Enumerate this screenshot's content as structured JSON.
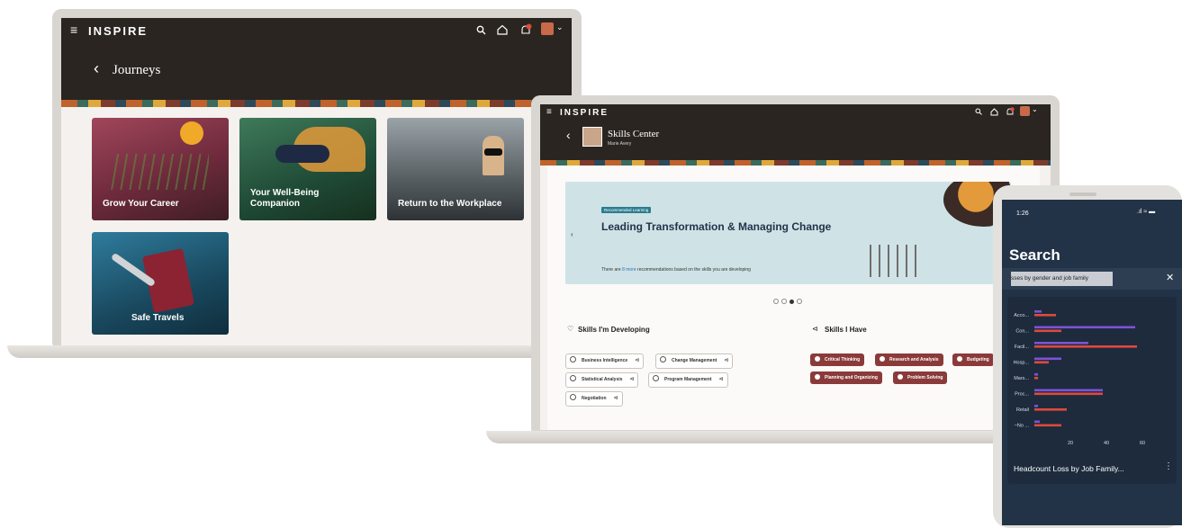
{
  "journeys_app": {
    "brand": "INSPIRE",
    "page_title": "Journeys",
    "tiles": [
      {
        "label": "Grow Your Career"
      },
      {
        "label": "Your Well-Being Companion"
      },
      {
        "label": "Return to the Workplace"
      },
      {
        "label": "Safe Travels"
      }
    ]
  },
  "skills_app": {
    "brand": "INSPIRE",
    "page_title": "Skills Center",
    "user_name": "Marie Avery",
    "carousel": {
      "tag": "Recommended Learning",
      "title": "Leading Transformation & Managing Change",
      "note_prefix": "There are ",
      "note_link": "8 more",
      "note_suffix": " recommendations based on the skills you are developing",
      "page_count": 4,
      "active_index": 2
    },
    "developing": {
      "heading": "Skills I'm Developing",
      "chips": [
        "Business Intelligence",
        "Change Management",
        "Statistical Analysis",
        "Program Management",
        "Negotiation"
      ]
    },
    "have": {
      "heading": "Skills I Have",
      "badges": [
        "Critical Thinking",
        "Research and Analysis",
        "Budgeting",
        "Planning and Organizing",
        "Problem Solving"
      ]
    }
  },
  "phone_app": {
    "time": "1:26",
    "title": "Search",
    "search_value": "sses by gender and job family",
    "chart_caption": "Headcount Loss by Job Family...",
    "chart_data": {
      "type": "bar",
      "orientation": "horizontal",
      "categories": [
        "Acco...",
        "Con...",
        "Facil...",
        "Hosp...",
        "Mars...",
        "Proc...",
        "Retail",
        "~No ..."
      ],
      "series": [
        {
          "color": "#7d52d6",
          "values": [
            4,
            56,
            30,
            15,
            2,
            38,
            2,
            3
          ]
        },
        {
          "color": "#e0493c",
          "values": [
            12,
            15,
            57,
            8,
            2,
            38,
            18,
            15
          ]
        }
      ],
      "x_ticks": [
        "20",
        "40",
        "60"
      ],
      "xlim": [
        0,
        70
      ]
    },
    "colors": {
      "bg": "#233347",
      "purple": "#7d52d6",
      "red": "#e0493c"
    }
  }
}
